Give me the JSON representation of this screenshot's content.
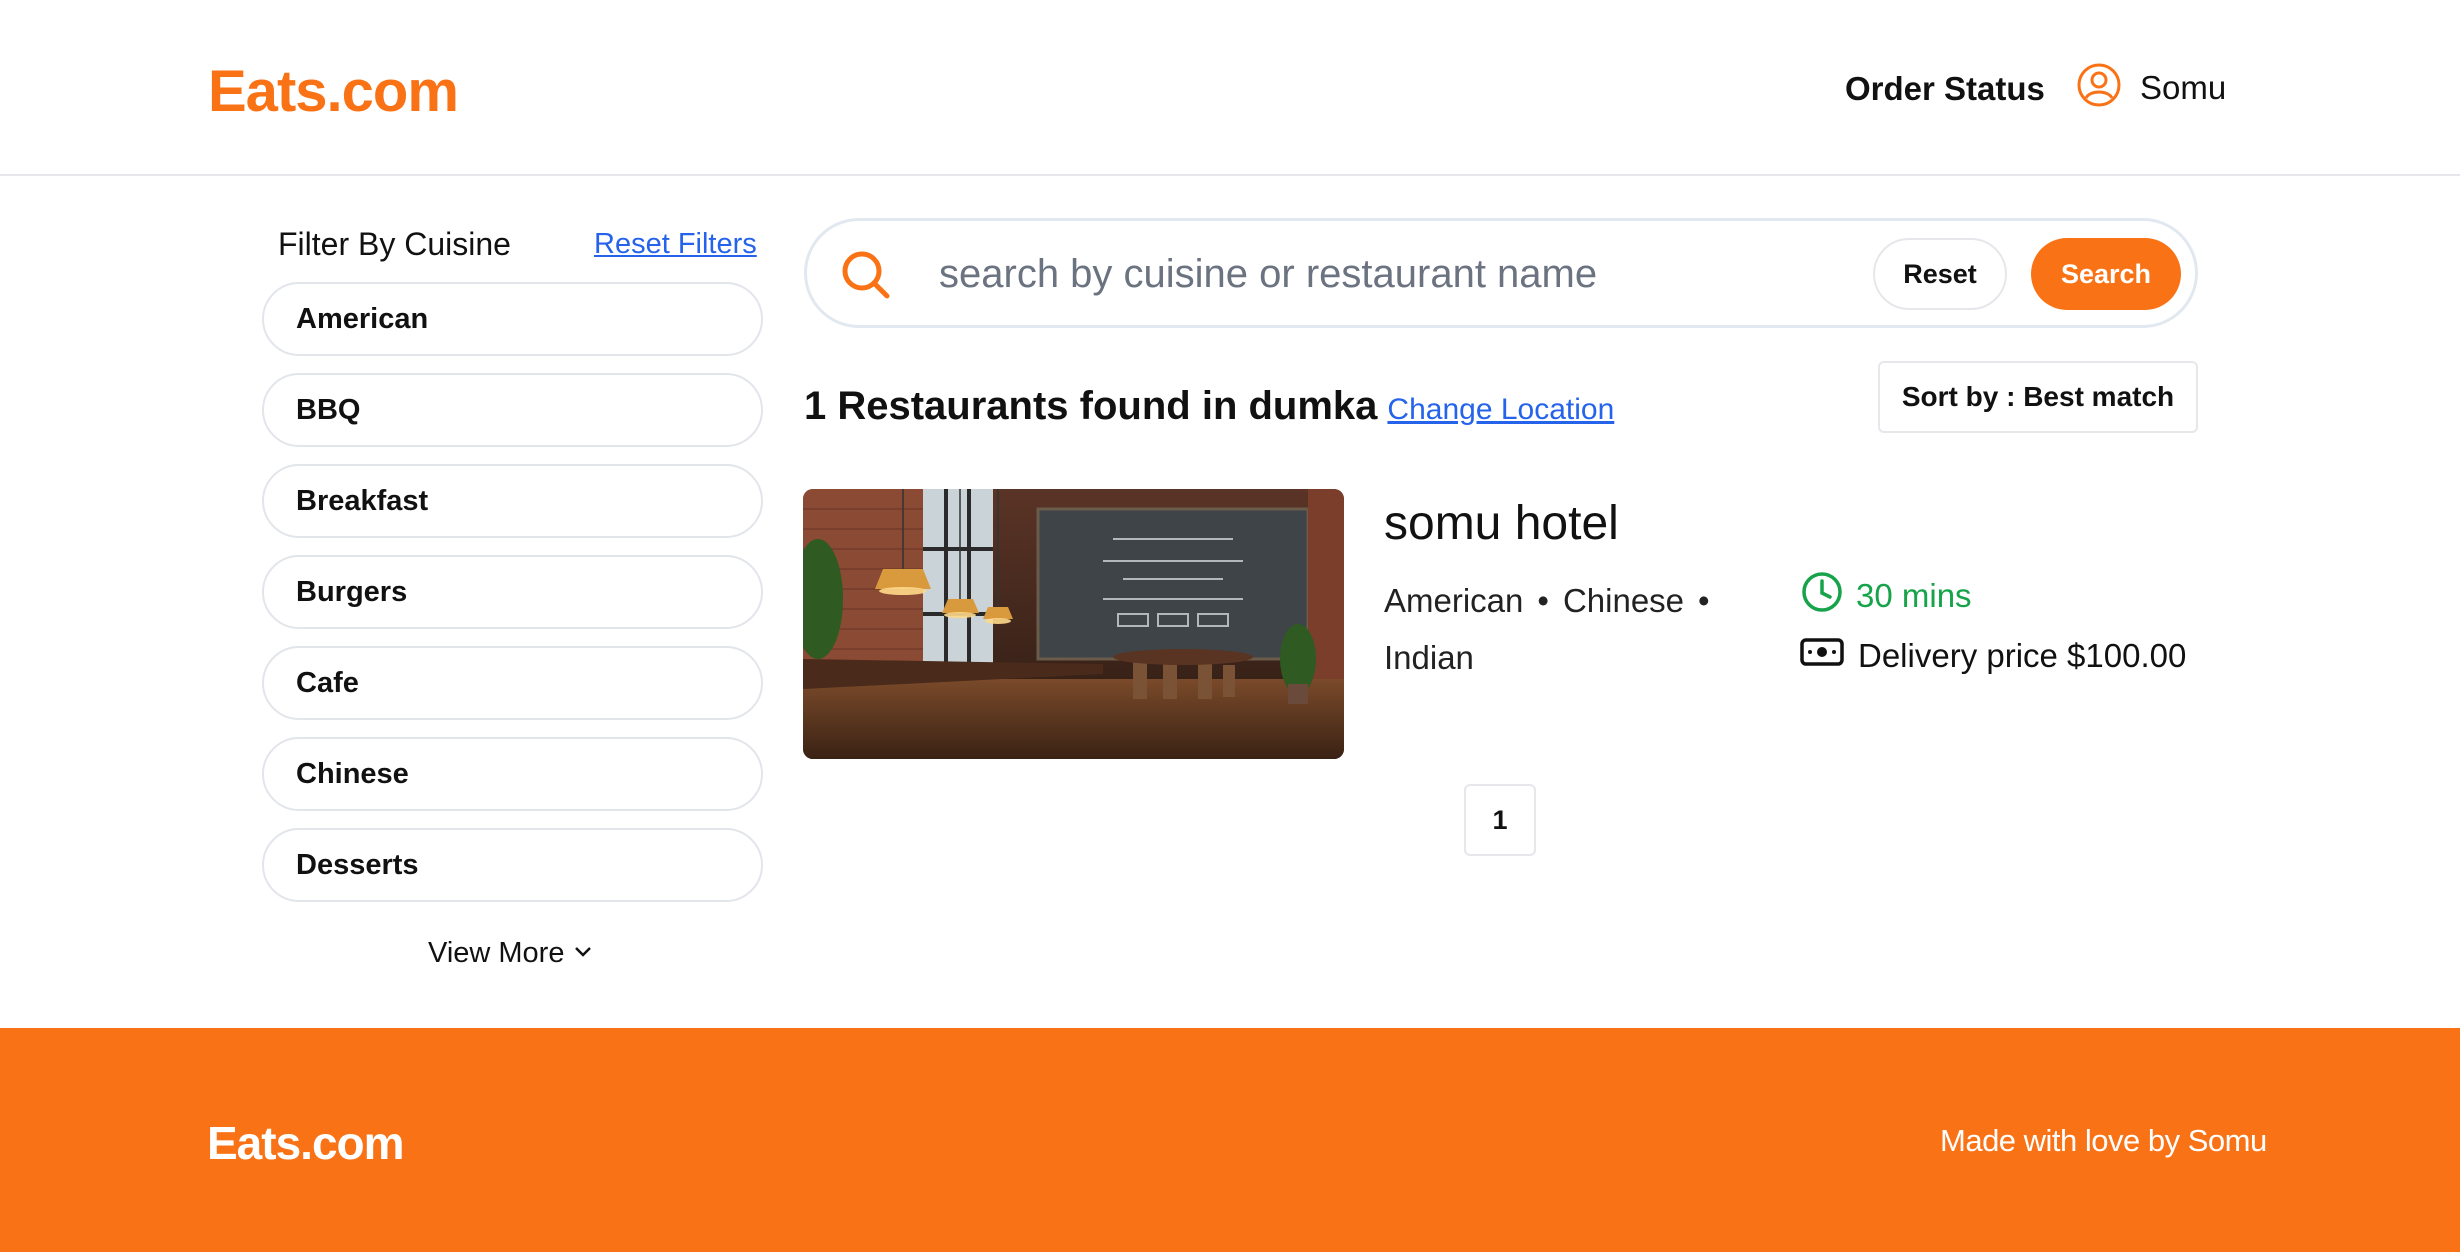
{
  "header": {
    "logo": "Eats.com",
    "nav_order_status": "Order Status",
    "user_name": "Somu"
  },
  "sidebar": {
    "title": "Filter By Cuisine",
    "reset_label": "Reset Filters",
    "cuisines": [
      "American",
      "BBQ",
      "Breakfast",
      "Burgers",
      "Cafe",
      "Chinese",
      "Desserts"
    ],
    "view_more": "View More"
  },
  "search": {
    "placeholder": "search by cuisine or restaurant name",
    "value": "",
    "reset_label": "Reset",
    "search_label": "Search"
  },
  "results": {
    "heading": "1 Restaurants found in dumka",
    "change_location": "Change Location",
    "sort_label": "Sort by : Best match"
  },
  "restaurant": {
    "name": "somu hotel",
    "cuisines": [
      "American",
      "Chinese",
      "Indian"
    ],
    "delivery_time": "30 mins",
    "delivery_price": "Delivery price $100.00"
  },
  "pagination": {
    "current_page": "1"
  },
  "footer": {
    "logo": "Eats.com",
    "tagline": "Made with love by Somu"
  },
  "colors": {
    "brand": "#f97316",
    "link": "#2563eb",
    "success": "#16a34a"
  }
}
